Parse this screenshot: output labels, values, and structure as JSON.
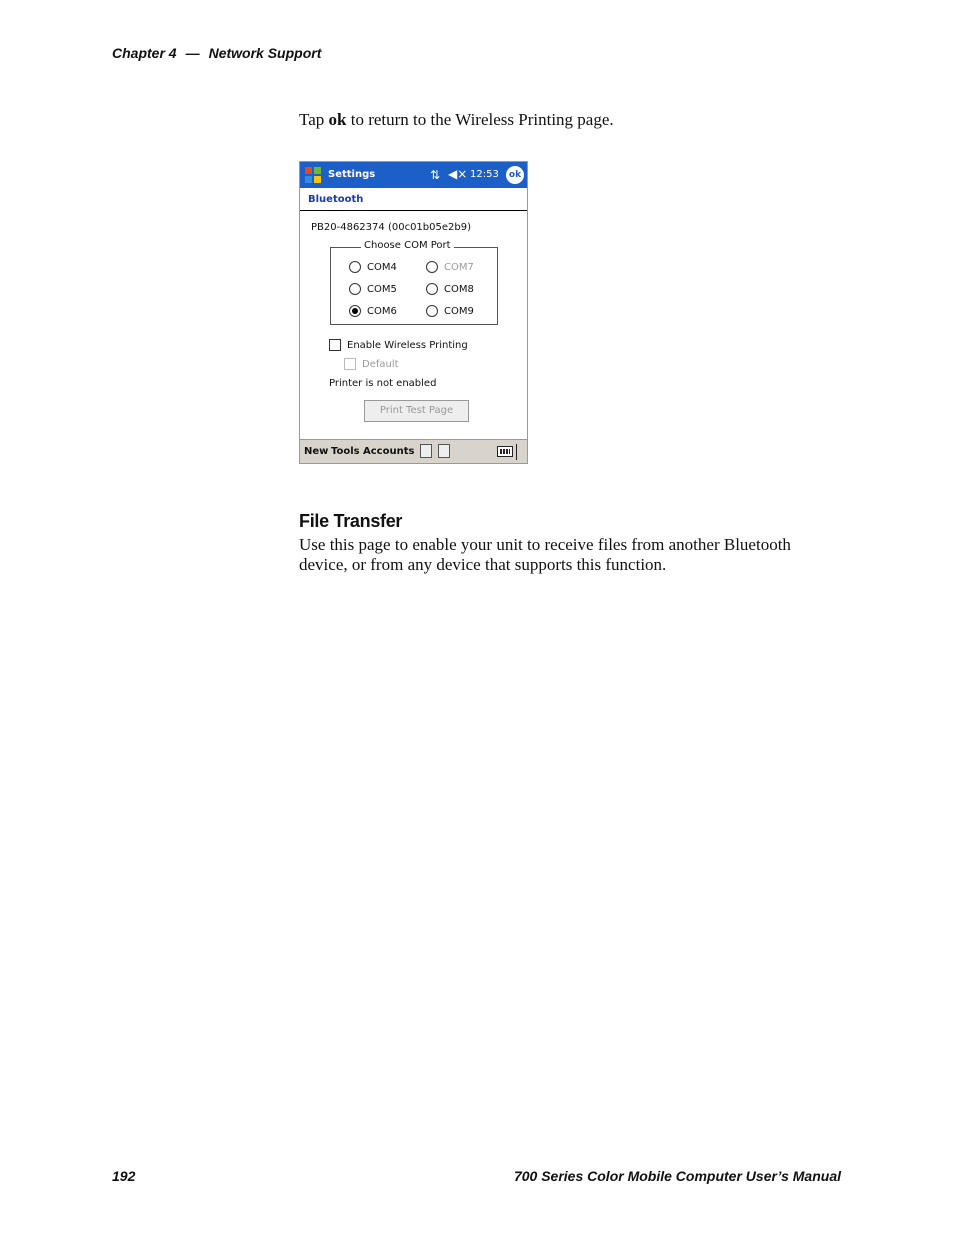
{
  "header": {
    "chapter": "Chapter 4",
    "dash": "—",
    "section": "Network Support"
  },
  "intro": {
    "pre": "Tap ",
    "bold": "ok",
    "post": " to return to the Wireless Printing page."
  },
  "device": {
    "titlebar": {
      "app": "Settings",
      "time": "12:53",
      "ok": "ok"
    },
    "subtitle": "Bluetooth",
    "device_id": "PB20-4862374 (00c01b05e2b9)",
    "com_group": {
      "title": "Choose COM Port",
      "ports": [
        {
          "label": "COM4",
          "selected": false,
          "enabled": true
        },
        {
          "label": "COM7",
          "selected": false,
          "enabled": false
        },
        {
          "label": "COM5",
          "selected": false,
          "enabled": true
        },
        {
          "label": "COM8",
          "selected": false,
          "enabled": true
        },
        {
          "label": "COM6",
          "selected": true,
          "enabled": true
        },
        {
          "label": "COM9",
          "selected": false,
          "enabled": true
        }
      ]
    },
    "enable_printing_label": "Enable Wireless Printing",
    "default_label": "Default",
    "status": "Printer is not enabled",
    "print_test_label": "Print Test Page",
    "menubar": {
      "new": "New",
      "tools": "Tools",
      "accounts": "Accounts"
    }
  },
  "section_heading": "File Transfer",
  "section_body": "Use this page to enable your unit to receive files from another Bluetooth device, or from any device that supports this function.",
  "footer": {
    "page": "192",
    "manual": "700 Series Color Mobile Computer User’s Manual"
  }
}
